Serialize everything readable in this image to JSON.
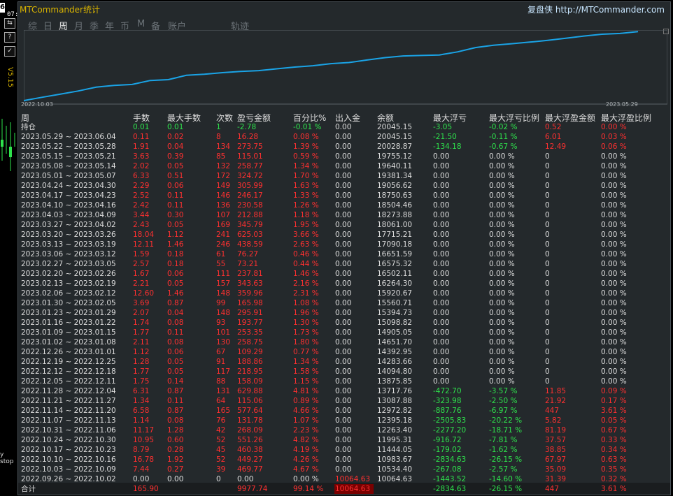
{
  "app": {
    "title": "MTCommander统计",
    "brand": "复盘侠 http://MTCommander.com"
  },
  "edge": {
    "num": "6",
    "time": "07:48:06",
    "icon1": "⇆",
    "icon2": "?",
    "icon3": "✓",
    "version": "V5.15",
    "stop": "y stop"
  },
  "tabs": [
    {
      "label": "综",
      "active": false
    },
    {
      "label": "日",
      "active": false
    },
    {
      "label": "周",
      "active": true
    },
    {
      "label": "月",
      "active": false
    },
    {
      "label": "季",
      "active": false
    },
    {
      "label": "年",
      "active": false
    },
    {
      "label": "币",
      "active": false
    },
    {
      "label": "M",
      "active": false
    },
    {
      "label": "备",
      "active": false
    },
    {
      "label": "账户",
      "active": false
    },
    {
      "label": "轨迹",
      "active": false
    }
  ],
  "chart_data": {
    "type": "line",
    "x_start": "2022.10.03",
    "x_end": "2023.05.29",
    "x": [
      "2022.10.03",
      "2022.10.10",
      "2022.10.17",
      "2022.10.24",
      "2022.10.31",
      "2022.11.07",
      "2022.11.14",
      "2022.11.21",
      "2022.11.28",
      "2022.12.05",
      "2022.12.12",
      "2022.12.19",
      "2022.12.26",
      "2023.01.02",
      "2023.01.09",
      "2023.01.16",
      "2023.01.23",
      "2023.01.30",
      "2023.02.06",
      "2023.02.13",
      "2023.02.20",
      "2023.02.27",
      "2023.03.06",
      "2023.03.13",
      "2023.03.20",
      "2023.03.27",
      "2023.04.03",
      "2023.04.10",
      "2023.04.17",
      "2023.04.24",
      "2023.05.01",
      "2023.05.08",
      "2023.05.15",
      "2023.05.22",
      "2023.05.29"
    ],
    "values": [
      10064.63,
      10534.4,
      10983.67,
      11444.05,
      11995.31,
      12263.4,
      12395.18,
      12972.82,
      13087.88,
      13717.76,
      13875.8,
      14094.8,
      14283.66,
      14392.95,
      14651.7,
      14905.05,
      15098.82,
      15394.73,
      15560.71,
      15920.67,
      16264.3,
      16502.11,
      16575.32,
      16651.59,
      17090.18,
      17715.21,
      18061.0,
      18273.88,
      18504.46,
      18750.63,
      19056.62,
      19381.34,
      19640.11,
      19755.12,
      20028.87
    ],
    "color": "#1aa3e6"
  },
  "headers": [
    "周",
    "手数",
    "最大手数",
    "次数",
    "盈亏金额",
    "百分比%",
    "出入金",
    "余额",
    "最大浮亏",
    "最大浮亏比例",
    "最大浮盈金额",
    "最大浮盈比例"
  ],
  "colors": {
    "red": "#ff3030",
    "green": "#2ee24c",
    "white": "#dcdcdc"
  },
  "rows": [
    {
      "cells": [
        "持仓",
        "0.01",
        "0.01",
        "1",
        "-2.78",
        "-0.01 %",
        "0.00",
        "20045.15",
        "-3.05",
        "-0.02 %",
        "0.52",
        "0.00 %"
      ],
      "tone": [
        "w",
        "g",
        "g",
        "g",
        "g",
        "g",
        "w",
        "w",
        "g",
        "g",
        "r",
        "r"
      ]
    },
    {
      "cells": [
        "2023.05.29 ~ 2023.06.04",
        "0.11",
        "0.02",
        "8",
        "16.28",
        "0.08 %",
        "0.00",
        "20045.15",
        "-21.50",
        "-0.11 %",
        "6.01",
        "0.03 %"
      ],
      "tone": [
        "w",
        "r",
        "r",
        "r",
        "r",
        "r",
        "w",
        "w",
        "g",
        "g",
        "r",
        "r"
      ]
    },
    {
      "cells": [
        "2023.05.22 ~ 2023.05.28",
        "1.91",
        "0.04",
        "134",
        "273.75",
        "1.39 %",
        "0.00",
        "20028.87",
        "-134.18",
        "-0.67 %",
        "12.49",
        "0.06 %"
      ],
      "tone": [
        "w",
        "r",
        "r",
        "r",
        "r",
        "r",
        "w",
        "w",
        "g",
        "g",
        "r",
        "r"
      ]
    },
    {
      "cells": [
        "2023.05.15 ~ 2023.05.21",
        "3.63",
        "0.39",
        "85",
        "115.01",
        "0.59 %",
        "0.00",
        "19755.12",
        "0.00",
        "0.00 %",
        "0",
        "0.00 %"
      ],
      "tone": [
        "w",
        "r",
        "r",
        "r",
        "r",
        "r",
        "w",
        "w",
        "w",
        "w",
        "w",
        "w"
      ]
    },
    {
      "cells": [
        "2023.05.08 ~ 2023.05.14",
        "2.02",
        "0.05",
        "132",
        "258.77",
        "1.34 %",
        "0.00",
        "19640.11",
        "0.00",
        "0.00 %",
        "0",
        "0.00 %"
      ],
      "tone": [
        "w",
        "r",
        "r",
        "r",
        "r",
        "r",
        "w",
        "w",
        "w",
        "w",
        "w",
        "w"
      ]
    },
    {
      "cells": [
        "2023.05.01 ~ 2023.05.07",
        "6.33",
        "0.51",
        "172",
        "324.72",
        "1.70 %",
        "0.00",
        "19381.34",
        "0.00",
        "0.00 %",
        "0",
        "0.00 %"
      ],
      "tone": [
        "w",
        "r",
        "r",
        "r",
        "r",
        "r",
        "w",
        "w",
        "w",
        "w",
        "w",
        "w"
      ]
    },
    {
      "cells": [
        "2023.04.24 ~ 2023.04.30",
        "2.29",
        "0.06",
        "149",
        "305.99",
        "1.63 %",
        "0.00",
        "19056.62",
        "0.00",
        "0.00 %",
        "0",
        "0.00 %"
      ],
      "tone": [
        "w",
        "r",
        "r",
        "r",
        "r",
        "r",
        "w",
        "w",
        "w",
        "w",
        "w",
        "w"
      ]
    },
    {
      "cells": [
        "2023.04.17 ~ 2023.04.23",
        "2.52",
        "0.11",
        "146",
        "246.17",
        "1.33 %",
        "0.00",
        "18750.63",
        "0.00",
        "0.00 %",
        "0",
        "0.00 %"
      ],
      "tone": [
        "w",
        "r",
        "r",
        "r",
        "r",
        "r",
        "w",
        "w",
        "w",
        "w",
        "w",
        "w"
      ]
    },
    {
      "cells": [
        "2023.04.10 ~ 2023.04.16",
        "2.42",
        "0.11",
        "136",
        "230.58",
        "1.26 %",
        "0.00",
        "18504.46",
        "0.00",
        "0.00 %",
        "0",
        "0.00 %"
      ],
      "tone": [
        "w",
        "r",
        "r",
        "r",
        "r",
        "r",
        "w",
        "w",
        "w",
        "w",
        "w",
        "w"
      ]
    },
    {
      "cells": [
        "2023.04.03 ~ 2023.04.09",
        "3.44",
        "0.30",
        "107",
        "212.88",
        "1.18 %",
        "0.00",
        "18273.88",
        "0.00",
        "0.00 %",
        "0",
        "0.00 %"
      ],
      "tone": [
        "w",
        "r",
        "r",
        "r",
        "r",
        "r",
        "w",
        "w",
        "w",
        "w",
        "w",
        "w"
      ]
    },
    {
      "cells": [
        "2023.03.27 ~ 2023.04.02",
        "2.43",
        "0.05",
        "169",
        "345.79",
        "1.95 %",
        "0.00",
        "18061.00",
        "0.00",
        "0.00 %",
        "0",
        "0.00 %"
      ],
      "tone": [
        "w",
        "r",
        "r",
        "r",
        "r",
        "r",
        "w",
        "w",
        "w",
        "w",
        "w",
        "w"
      ]
    },
    {
      "cells": [
        "2023.03.20 ~ 2023.03.26",
        "18.04",
        "1.12",
        "241",
        "625.03",
        "3.66 %",
        "0.00",
        "17715.21",
        "0.00",
        "0.00 %",
        "0",
        "0.00 %"
      ],
      "tone": [
        "w",
        "r",
        "r",
        "r",
        "r",
        "r",
        "w",
        "w",
        "w",
        "w",
        "w",
        "w"
      ]
    },
    {
      "cells": [
        "2023.03.13 ~ 2023.03.19",
        "12.11",
        "1.46",
        "246",
        "438.59",
        "2.63 %",
        "0.00",
        "17090.18",
        "0.00",
        "0.00 %",
        "0",
        "0.00 %"
      ],
      "tone": [
        "w",
        "r",
        "r",
        "r",
        "r",
        "r",
        "w",
        "w",
        "w",
        "w",
        "w",
        "w"
      ]
    },
    {
      "cells": [
        "2023.03.06 ~ 2023.03.12",
        "1.59",
        "0.18",
        "61",
        "76.27",
        "0.46 %",
        "0.00",
        "16651.59",
        "0.00",
        "0.00 %",
        "0",
        "0.00 %"
      ],
      "tone": [
        "w",
        "r",
        "r",
        "r",
        "r",
        "r",
        "w",
        "w",
        "w",
        "w",
        "w",
        "w"
      ]
    },
    {
      "cells": [
        "2023.02.27 ~ 2023.03.05",
        "2.57",
        "0.18",
        "55",
        "73.21",
        "0.44 %",
        "0.00",
        "16575.32",
        "0.00",
        "0.00 %",
        "0",
        "0.00 %"
      ],
      "tone": [
        "w",
        "r",
        "r",
        "r",
        "r",
        "r",
        "w",
        "w",
        "w",
        "w",
        "w",
        "w"
      ]
    },
    {
      "cells": [
        "2023.02.20 ~ 2023.02.26",
        "1.67",
        "0.06",
        "111",
        "237.81",
        "1.46 %",
        "0.00",
        "16502.11",
        "0.00",
        "0.00 %",
        "0",
        "0.00 %"
      ],
      "tone": [
        "w",
        "r",
        "r",
        "r",
        "r",
        "r",
        "w",
        "w",
        "w",
        "w",
        "w",
        "w"
      ]
    },
    {
      "cells": [
        "2023.02.13 ~ 2023.02.19",
        "2.21",
        "0.05",
        "157",
        "343.63",
        "2.16 %",
        "0.00",
        "16264.30",
        "0.00",
        "0.00 %",
        "0",
        "0.00 %"
      ],
      "tone": [
        "w",
        "r",
        "r",
        "r",
        "r",
        "r",
        "w",
        "w",
        "w",
        "w",
        "w",
        "w"
      ]
    },
    {
      "cells": [
        "2023.02.06 ~ 2023.02.12",
        "12.60",
        "1.46",
        "148",
        "359.96",
        "2.31 %",
        "0.00",
        "15920.67",
        "0.00",
        "0.00 %",
        "0",
        "0.00 %"
      ],
      "tone": [
        "w",
        "r",
        "r",
        "r",
        "r",
        "r",
        "w",
        "w",
        "w",
        "w",
        "w",
        "w"
      ]
    },
    {
      "cells": [
        "2023.01.30 ~ 2023.02.05",
        "3.69",
        "0.87",
        "99",
        "165.98",
        "1.08 %",
        "0.00",
        "15560.71",
        "0.00",
        "0.00 %",
        "0",
        "0.00 %"
      ],
      "tone": [
        "w",
        "r",
        "r",
        "r",
        "r",
        "r",
        "w",
        "w",
        "w",
        "w",
        "w",
        "w"
      ]
    },
    {
      "cells": [
        "2023.01.23 ~ 2023.01.29",
        "2.07",
        "0.04",
        "148",
        "295.91",
        "1.96 %",
        "0.00",
        "15394.73",
        "0.00",
        "0.00 %",
        "0",
        "0.00 %"
      ],
      "tone": [
        "w",
        "r",
        "r",
        "r",
        "r",
        "r",
        "w",
        "w",
        "w",
        "w",
        "w",
        "w"
      ]
    },
    {
      "cells": [
        "2023.01.16 ~ 2023.01.22",
        "1.74",
        "0.08",
        "93",
        "193.77",
        "1.30 %",
        "0.00",
        "15098.82",
        "0.00",
        "0.00 %",
        "0",
        "0.00 %"
      ],
      "tone": [
        "w",
        "r",
        "r",
        "r",
        "r",
        "r",
        "w",
        "w",
        "w",
        "w",
        "w",
        "w"
      ]
    },
    {
      "cells": [
        "2023.01.09 ~ 2023.01.15",
        "1.77",
        "0.11",
        "101",
        "253.35",
        "1.73 %",
        "0.00",
        "14905.05",
        "0.00",
        "0.00 %",
        "0",
        "0.00 %"
      ],
      "tone": [
        "w",
        "r",
        "r",
        "r",
        "r",
        "r",
        "w",
        "w",
        "w",
        "w",
        "w",
        "w"
      ]
    },
    {
      "cells": [
        "2023.01.02 ~ 2023.01.08",
        "2.11",
        "0.08",
        "130",
        "258.75",
        "1.80 %",
        "0.00",
        "14651.70",
        "0.00",
        "0.00 %",
        "0",
        "0.00 %"
      ],
      "tone": [
        "w",
        "r",
        "r",
        "r",
        "r",
        "r",
        "w",
        "w",
        "w",
        "w",
        "w",
        "w"
      ]
    },
    {
      "cells": [
        "2022.12.26 ~ 2023.01.01",
        "1.12",
        "0.06",
        "67",
        "109.29",
        "0.77 %",
        "0.00",
        "14392.95",
        "0.00",
        "0.00 %",
        "0",
        "0.00 %"
      ],
      "tone": [
        "w",
        "r",
        "r",
        "r",
        "r",
        "r",
        "w",
        "w",
        "w",
        "w",
        "w",
        "w"
      ]
    },
    {
      "cells": [
        "2022.12.19 ~ 2022.12.25",
        "1.28",
        "0.05",
        "91",
        "188.86",
        "1.34 %",
        "0.00",
        "14283.66",
        "0.00",
        "0.00 %",
        "0",
        "0.00 %"
      ],
      "tone": [
        "w",
        "r",
        "r",
        "r",
        "r",
        "r",
        "w",
        "w",
        "w",
        "w",
        "w",
        "w"
      ]
    },
    {
      "cells": [
        "2022.12.12 ~ 2022.12.18",
        "1.77",
        "0.05",
        "117",
        "218.95",
        "1.58 %",
        "0.00",
        "14094.80",
        "0.00",
        "0.00 %",
        "0",
        "0.00 %"
      ],
      "tone": [
        "w",
        "r",
        "r",
        "r",
        "r",
        "r",
        "w",
        "w",
        "w",
        "w",
        "w",
        "w"
      ]
    },
    {
      "cells": [
        "2022.12.05 ~ 2022.12.11",
        "1.75",
        "0.14",
        "88",
        "158.09",
        "1.15 %",
        "0.00",
        "13875.85",
        "0.00",
        "0.00 %",
        "0",
        "0.00 %"
      ],
      "tone": [
        "w",
        "r",
        "r",
        "r",
        "r",
        "r",
        "w",
        "w",
        "w",
        "w",
        "w",
        "w"
      ]
    },
    {
      "cells": [
        "2022.11.28 ~ 2022.12.04",
        "6.31",
        "0.87",
        "131",
        "629.88",
        "4.81 %",
        "0.00",
        "13717.76",
        "-472.70",
        "-3.57 %",
        "11.85",
        "0.09 %"
      ],
      "tone": [
        "w",
        "r",
        "r",
        "r",
        "r",
        "r",
        "w",
        "w",
        "g",
        "g",
        "r",
        "r"
      ]
    },
    {
      "cells": [
        "2022.11.21 ~ 2022.11.27",
        "1.34",
        "0.11",
        "64",
        "115.06",
        "0.89 %",
        "0.00",
        "13087.88",
        "-323.98",
        "-2.50 %",
        "21.92",
        "0.17 %"
      ],
      "tone": [
        "w",
        "r",
        "r",
        "r",
        "r",
        "r",
        "w",
        "w",
        "g",
        "g",
        "r",
        "r"
      ]
    },
    {
      "cells": [
        "2022.11.14 ~ 2022.11.20",
        "6.58",
        "0.87",
        "165",
        "577.64",
        "4.66 %",
        "0.00",
        "12972.82",
        "-887.76",
        "-6.97 %",
        "447",
        "3.61 %"
      ],
      "tone": [
        "w",
        "r",
        "r",
        "r",
        "r",
        "r",
        "w",
        "w",
        "g",
        "g",
        "r",
        "r"
      ]
    },
    {
      "cells": [
        "2022.11.07 ~ 2022.11.13",
        "1.14",
        "0.08",
        "76",
        "131.78",
        "1.07 %",
        "0.00",
        "12395.18",
        "-2505.83",
        "-20.22 %",
        "5.82",
        "0.05 %"
      ],
      "tone": [
        "w",
        "r",
        "r",
        "r",
        "r",
        "r",
        "w",
        "w",
        "g",
        "g",
        "r",
        "r"
      ]
    },
    {
      "cells": [
        "2022.10.31 ~ 2022.11.06",
        "11.17",
        "1.28",
        "42",
        "268.09",
        "2.23 %",
        "0.00",
        "12263.40",
        "-2277.20",
        "-18.71 %",
        "81.19",
        "0.67 %"
      ],
      "tone": [
        "w",
        "r",
        "r",
        "r",
        "r",
        "r",
        "w",
        "w",
        "g",
        "g",
        "r",
        "r"
      ]
    },
    {
      "cells": [
        "2022.10.24 ~ 2022.10.30",
        "10.95",
        "0.60",
        "52",
        "551.26",
        "4.82 %",
        "0.00",
        "11995.31",
        "-916.72",
        "-7.81 %",
        "37.57",
        "0.33 %"
      ],
      "tone": [
        "w",
        "r",
        "r",
        "r",
        "r",
        "r",
        "w",
        "w",
        "g",
        "g",
        "r",
        "r"
      ]
    },
    {
      "cells": [
        "2022.10.17 ~ 2022.10.23",
        "8.79",
        "0.28",
        "45",
        "460.38",
        "4.19 %",
        "0.00",
        "11444.05",
        "-179.02",
        "-1.62 %",
        "38.85",
        "0.34 %"
      ],
      "tone": [
        "w",
        "r",
        "r",
        "r",
        "r",
        "r",
        "w",
        "w",
        "g",
        "g",
        "r",
        "r"
      ]
    },
    {
      "cells": [
        "2022.10.10 ~ 2022.10.16",
        "16.78",
        "1.92",
        "52",
        "449.27",
        "4.26 %",
        "0.00",
        "10983.67",
        "-2834.63",
        "-26.15 %",
        "67.97",
        "0.63 %"
      ],
      "tone": [
        "w",
        "r",
        "r",
        "r",
        "r",
        "r",
        "w",
        "w",
        "g",
        "g",
        "r",
        "r"
      ]
    },
    {
      "cells": [
        "2022.10.03 ~ 2022.10.09",
        "7.44",
        "0.27",
        "39",
        "469.77",
        "4.67 %",
        "0.00",
        "10534.40",
        "-267.08",
        "-2.57 %",
        "35.09",
        "0.35 %"
      ],
      "tone": [
        "w",
        "r",
        "r",
        "r",
        "r",
        "r",
        "w",
        "w",
        "g",
        "g",
        "r",
        "r"
      ]
    },
    {
      "cells": [
        "2022.09.26 ~ 2022.10.02",
        "0.00",
        "0.00",
        "0",
        "0.00",
        "0.00 %",
        "10064.63",
        "10064.63",
        "-1443.52",
        "-14.60 %",
        "31.39",
        "0.32 %"
      ],
      "tone": [
        "w",
        "w",
        "w",
        "w",
        "w",
        "w",
        "r",
        "w",
        "g",
        "g",
        "r",
        "r"
      ]
    }
  ],
  "total": {
    "cells": [
      "合计",
      "165.90",
      "",
      "",
      "9977.74",
      "99.14 %",
      "10064.63",
      "",
      "-2834.63",
      "-26.15 %",
      "447",
      "3.61 %"
    ],
    "tone": [
      "w",
      "r",
      "w",
      "w",
      "r",
      "r",
      "r",
      "w",
      "g",
      "g",
      "r",
      "r"
    ]
  }
}
